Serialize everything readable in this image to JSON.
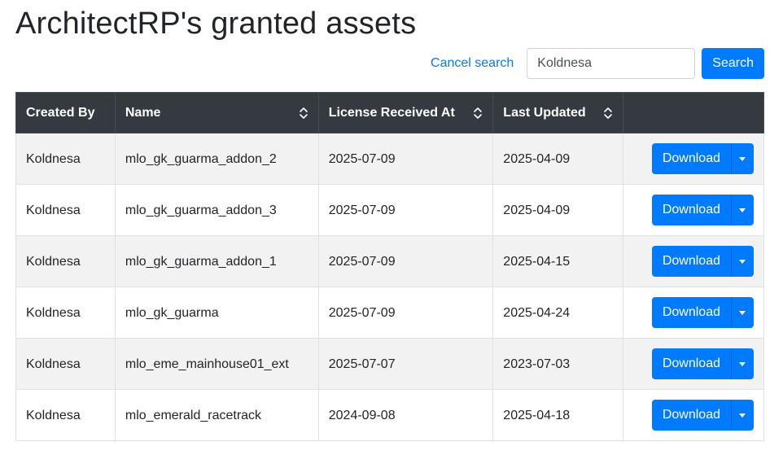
{
  "title": "ArchitectRP's granted assets",
  "search": {
    "cancel_label": "Cancel search",
    "value": "Koldnesa",
    "button_label": "Search"
  },
  "table": {
    "columns": [
      {
        "label": "Created By",
        "sortable": false
      },
      {
        "label": "Name",
        "sortable": true
      },
      {
        "label": "License Received At",
        "sortable": true
      },
      {
        "label": "Last Updated",
        "sortable": true
      },
      {
        "label": "",
        "sortable": false
      }
    ],
    "rows": [
      {
        "created_by": "Koldnesa",
        "name": "mlo_gk_guarma_addon_2",
        "license_received_at": "2025-07-09",
        "last_updated": "2025-04-09",
        "action_label": "Download"
      },
      {
        "created_by": "Koldnesa",
        "name": "mlo_gk_guarma_addon_3",
        "license_received_at": "2025-07-09",
        "last_updated": "2025-04-09",
        "action_label": "Download"
      },
      {
        "created_by": "Koldnesa",
        "name": "mlo_gk_guarma_addon_1",
        "license_received_at": "2025-07-09",
        "last_updated": "2025-04-15",
        "action_label": "Download"
      },
      {
        "created_by": "Koldnesa",
        "name": "mlo_gk_guarma",
        "license_received_at": "2025-07-09",
        "last_updated": "2025-04-24",
        "action_label": "Download"
      },
      {
        "created_by": "Koldnesa",
        "name": "mlo_eme_mainhouse01_ext",
        "license_received_at": "2025-07-07",
        "last_updated": "2023-07-03",
        "action_label": "Download"
      },
      {
        "created_by": "Koldnesa",
        "name": "mlo_emerald_racetrack",
        "license_received_at": "2024-09-08",
        "last_updated": "2025-04-18",
        "action_label": "Download"
      }
    ]
  },
  "icons": {
    "sort": "sort-icon",
    "dropdown": "caret-down-icon"
  },
  "colors": {
    "primary": "#007bff",
    "header_bg": "#343a40",
    "stripe_bg": "#f2f2f2",
    "link": "#007bff"
  }
}
